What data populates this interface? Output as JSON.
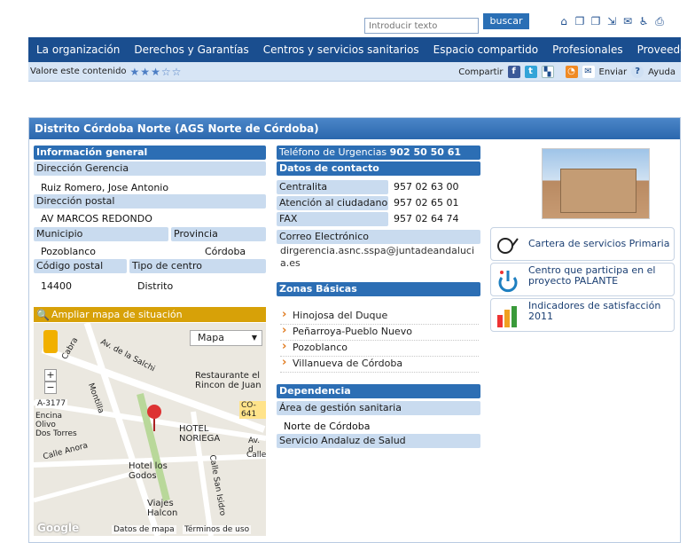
{
  "search": {
    "placeholder": "Introducir texto",
    "button": "buscar"
  },
  "nav": [
    "La organización",
    "Derechos y Garantías",
    "Centros y servicios sanitarios",
    "Espacio compartido",
    "Profesionales",
    "Proveedores"
  ],
  "rating": {
    "label": "Valore este contenido",
    "stars_filled": 3,
    "stars_total": 5
  },
  "share": {
    "label": "Compartir",
    "send": "Enviar",
    "help": "Ayuda"
  },
  "card": {
    "title": "Distrito Córdoba Norte (AGS Norte de Córdoba)"
  },
  "info": {
    "heading": "Información general",
    "gerencia_label": "Dirección Gerencia",
    "gerencia_value": "Ruiz Romero, Jose Antonio",
    "postal_label": "Dirección postal",
    "postal_value": "AV MARCOS REDONDO",
    "municipio_label": "Municipio",
    "municipio_value": "Pozoblanco",
    "provincia_label": "Provincia",
    "provincia_value": "Córdoba",
    "cp_label": "Código postal",
    "cp_value": "14400",
    "tipo_label": "Tipo de centro",
    "tipo_value": "Distrito"
  },
  "map": {
    "header": "Ampliar mapa de situación",
    "type_select": "Mapa",
    "labels": [
      "Restaurante el",
      "Rincon de Juan",
      "HOTEL",
      "NORIEGA",
      "Hotel los",
      "Godos",
      "Viajes",
      "Halcon",
      "A-3177",
      "CO-641",
      "Av. de la Salchi",
      "Montilla",
      "Calle San Isidro",
      "Calle Anora",
      "Encina",
      "Olivo",
      "Dos Torres",
      "Av. d",
      "Calle",
      "Cabra"
    ],
    "footer": [
      "Datos de mapa",
      "Términos de uso"
    ],
    "google": "Google"
  },
  "contact": {
    "urgencias_label": "Teléfono de Urgencias",
    "urgencias_value": "902 50 50 61",
    "heading": "Datos de contacto",
    "rows": [
      {
        "label": "Centralita",
        "value": "957 02 63 00"
      },
      {
        "label": "Atención al ciudadano",
        "value": "957 02 65 01"
      },
      {
        "label": "FAX",
        "value": "957 02 64 74"
      }
    ],
    "email_label": "Correo Electrónico",
    "email_value": "dirgerencia.asnc.sspa@juntadeandalucia.es"
  },
  "zonas": {
    "heading": "Zonas Básicas",
    "items": [
      "Hinojosa del Duque",
      "Peñarroya-Pueblo Nuevo",
      "Pozoblanco",
      "Villanueva de Córdoba"
    ]
  },
  "dependencia": {
    "heading": "Dependencia",
    "area_label": "Área de gestión sanitaria",
    "area_value": "Norte de Córdoba",
    "sas": "Servicio Andaluz de Salud"
  },
  "side_links": [
    {
      "text": "Cartera de servicios Primaria",
      "icon": "stethoscope-icon"
    },
    {
      "text": "Centro que participa en el proyecto PALANTE",
      "icon": "power-icon"
    },
    {
      "text": "Indicadores de satisfacción 2011",
      "icon": "bar-chart-icon"
    }
  ]
}
